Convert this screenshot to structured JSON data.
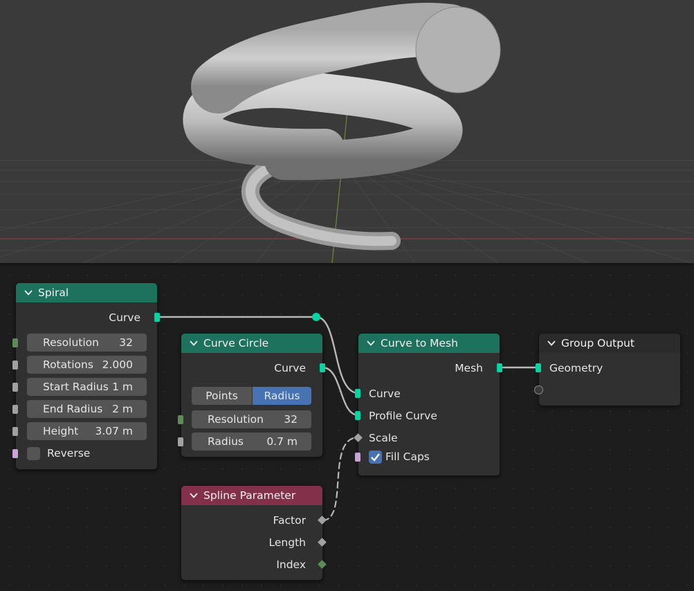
{
  "viewport": {
    "description_icon": "3d-viewport-spiral-tube"
  },
  "nodes": {
    "spiral": {
      "title": "Spiral",
      "output_curve": "Curve",
      "fields": [
        {
          "label": "Resolution",
          "value": "32"
        },
        {
          "label": "Rotations",
          "value": "2.000"
        },
        {
          "label": "Start Radius",
          "value": "1 m"
        },
        {
          "label": "End Radius",
          "value": "2 m"
        },
        {
          "label": "Height",
          "value": "3.07 m"
        }
      ],
      "reverse_label": "Reverse",
      "reverse_checked": false
    },
    "curve_circle": {
      "title": "Curve Circle",
      "output_curve": "Curve",
      "modes": [
        "Points",
        "Radius"
      ],
      "active_mode": "Radius",
      "fields": [
        {
          "label": "Resolution",
          "value": "32"
        },
        {
          "label": "Radius",
          "value": "0.7 m"
        }
      ]
    },
    "curve_to_mesh": {
      "title": "Curve to Mesh",
      "output_mesh": "Mesh",
      "input_curve": "Curve",
      "input_profile": "Profile Curve",
      "input_scale": "Scale",
      "fill_caps_label": "Fill Caps",
      "fill_caps_checked": true
    },
    "group_output": {
      "title": "Group Output",
      "input_geometry": "Geometry"
    },
    "spline_parameter": {
      "title": "Spline Parameter",
      "outputs": [
        "Factor",
        "Length",
        "Index"
      ]
    }
  },
  "colors": {
    "geometry_header": "#1d725d",
    "input_header": "#83314a",
    "geometry_socket": "#00d6a3",
    "active_button": "#4772b3"
  }
}
